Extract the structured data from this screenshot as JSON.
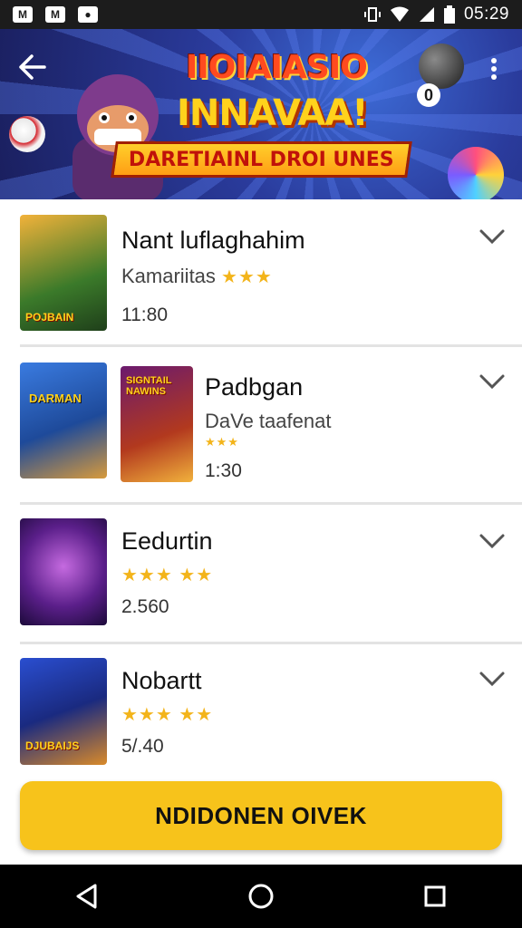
{
  "status_bar": {
    "icons": [
      "gmail-icon",
      "mail-icon",
      "app-icon"
    ],
    "right_icons": [
      "vibrate-icon",
      "wifi-icon",
      "signal-icon",
      "battery-icon"
    ],
    "time": "05:29"
  },
  "banner": {
    "title": "IIOIAIASIO",
    "subtitle": "INNAVAA!",
    "ribbon": "DARETIAINL DROI UNES",
    "badge": "0"
  },
  "items": [
    {
      "title": "Nant luflaghahim",
      "subtitle": "Kamariitas",
      "stars": "★★★",
      "meta": "11:80",
      "thumb_label": "POJBAIN"
    },
    {
      "title": "Padbgan",
      "subtitle": "DaVe taafenat",
      "stars": "★★★",
      "meta": "1:30",
      "thumb_label": "DARMAN",
      "thumb2_label": "SIGNTAIL NAWINS"
    },
    {
      "title": "Eedurtin",
      "subtitle": "",
      "stars": "★★★ ★★",
      "meta": "2.560",
      "thumb_label": ""
    },
    {
      "title": "Nobartt",
      "subtitle": "",
      "stars": "★★★ ★★",
      "meta": "5/.40",
      "thumb_label": "DJUBAIJS"
    }
  ],
  "cta": {
    "label": "NDIDONEN OIVEK"
  },
  "colors": {
    "accent": "#f7c31b",
    "banner_bg": "#2a3b9c",
    "star": "#f3b41a"
  }
}
